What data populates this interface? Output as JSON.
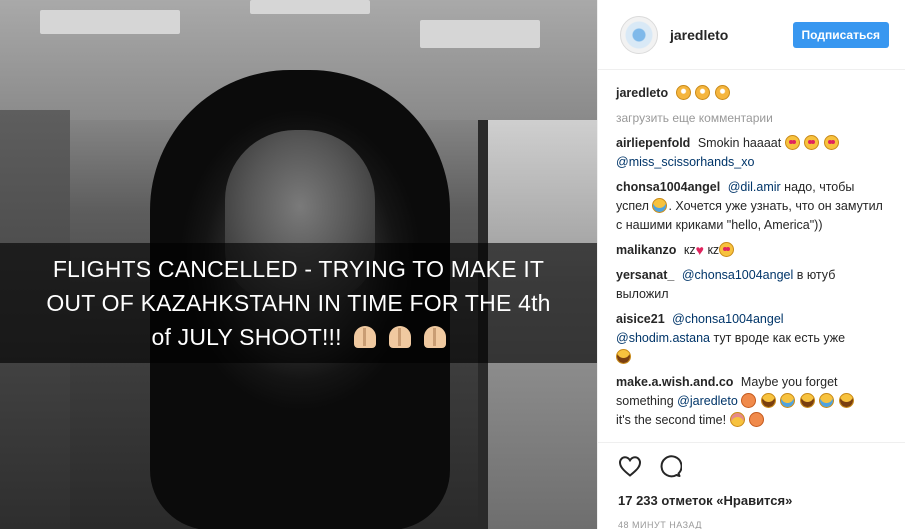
{
  "post": {
    "caption_lines": [
      "FLIGHTS CANCELLED - TRYING TO MAKE IT",
      "OUT OF KAZAHKSTAHN IN TIME FOR THE 4th",
      "of JULY SHOOT!!!"
    ],
    "caption_emoji": "pray-icon"
  },
  "header": {
    "username": "jaredleto",
    "follow_label": "Подписаться"
  },
  "owner_comment": {
    "author": "jaredleto"
  },
  "load_more": "загрузить еще комментарии",
  "comments": [
    {
      "author": "airliepenfold",
      "text": "Smokin haaaat",
      "mention": "@miss_scissorhands_xo"
    },
    {
      "author": "chonsa1004angel",
      "mention": "@dil.amir",
      "text": " надо, чтобы успел",
      "text2": ". Хочется уже узнать, что он замутил с нашими криками \"hello, America\"))"
    },
    {
      "author": "malikanzo",
      "text1": "кz",
      "text2": "кz"
    },
    {
      "author": "yersanat_",
      "mention": "@chonsa1004angel",
      "text": " в ютуб выложил"
    },
    {
      "author": "aisice21",
      "mention": "@chonsa1004angel",
      "mention2": "@shodim.astana",
      "text": " тут вроде как есть уже"
    },
    {
      "author": "make.a.wish.and.co",
      "text": "Maybe you forget something",
      "mention": "@jaredleto",
      "text2": "it's the second time!"
    }
  ],
  "likes": "17 233 отметок «Нравится»",
  "timestamp": "48 минут назад",
  "icons": {
    "like": "heart-icon",
    "comment": "comment-icon"
  },
  "colors": {
    "accent": "#3897f0",
    "mention": "#003569",
    "muted": "#999999"
  }
}
